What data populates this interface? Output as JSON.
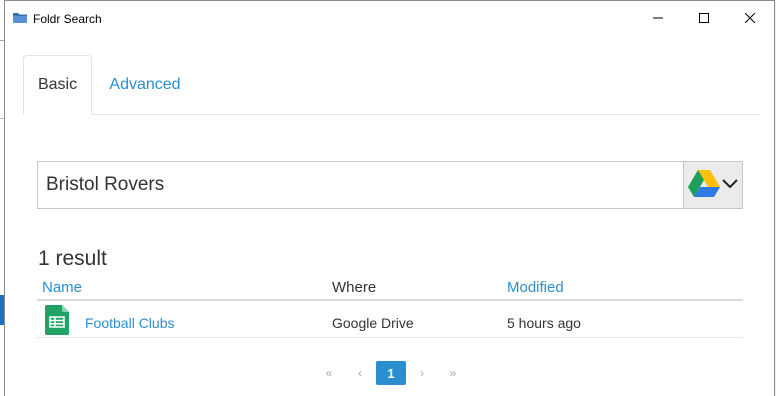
{
  "window": {
    "title": "Foldr Search",
    "controls": {
      "minimize": "minimize",
      "maximize": "maximize",
      "close": "close"
    }
  },
  "tabs": [
    {
      "label": "Basic",
      "active": true
    },
    {
      "label": "Advanced",
      "active": false
    }
  ],
  "search": {
    "value": "Bristol Rovers",
    "source_icon": "google-drive-icon",
    "dropdown_icon": "chevron-down-icon"
  },
  "results": {
    "count_text": "1 result",
    "columns": {
      "name": "Name",
      "where": "Where",
      "modified": "Modified"
    },
    "rows": [
      {
        "icon": "google-sheets-icon",
        "name": "Football Clubs",
        "where": "Google Drive",
        "modified": "5 hours ago"
      }
    ]
  },
  "pagination": {
    "first": "«",
    "prev": "‹",
    "current": "1",
    "next": "›",
    "last": "»"
  },
  "colors": {
    "accent": "#2a8fcf",
    "sheets_green": "#21a366"
  }
}
